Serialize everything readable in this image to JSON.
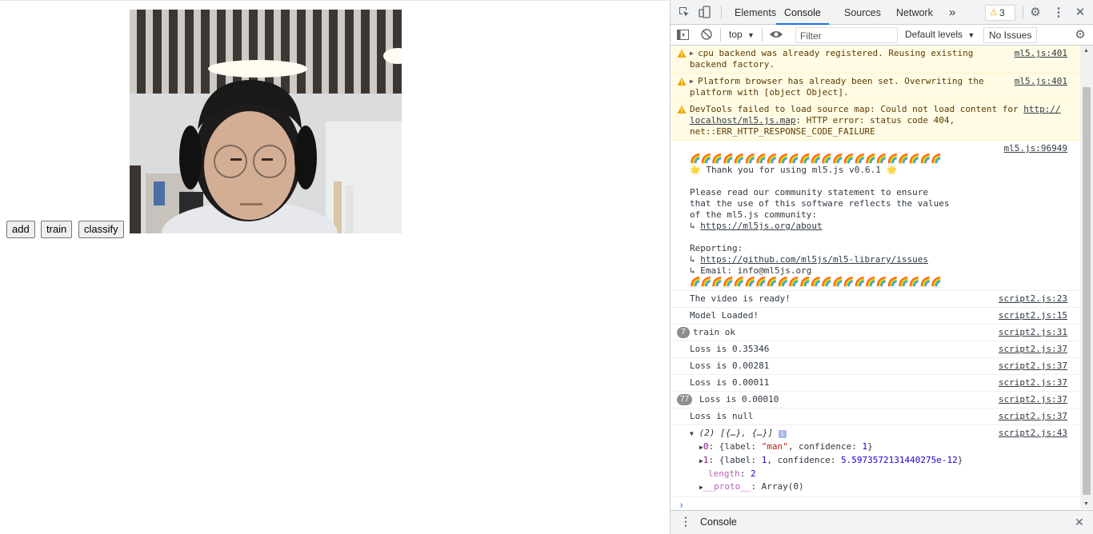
{
  "page": {
    "buttons": {
      "add": "add",
      "train": "train",
      "classify": "classify"
    }
  },
  "devtools": {
    "tabs": [
      "Elements",
      "Console",
      "Sources",
      "Network"
    ],
    "more_tabs": "»",
    "warnings_badge": "3",
    "context": "top",
    "filter_placeholder": "Filter",
    "levels": "Default levels",
    "issues": "No Issues",
    "drawer_tab": "Console",
    "messages": {
      "w1": {
        "text": "cpu backend was already registered. Reusing existing\nbackend factory.",
        "src": "ml5.js:401"
      },
      "w2": {
        "text": "Platform browser has already been set. Overwriting the\nplatform with [object Object].",
        "src": "ml5.js:401"
      },
      "w3": {
        "text_a": "DevTools failed to load source map: Could not load content for ",
        "link": "http://\nlocalhost/ml5.js.map",
        "text_b": ": HTTP error: status code 404,\nnet::ERR_HTTP_RESPONSE_CODE_FAILURE"
      },
      "banner": {
        "src": "ml5.js:96949",
        "rainbow": "🌈🌈🌈🌈🌈🌈🌈🌈🌈🌈🌈🌈🌈🌈🌈🌈🌈🌈🌈🌈🌈🌈🌈",
        "thanks": "🌟 Thank you for using ml5.js v0.6.1 🌟",
        "p1": "Please read our community statement to ensure\nthat the use of this software reflects the values\nof the ml5.js community:",
        "arrow1": "↳ ",
        "about": "https://ml5js.org/about",
        "reporting": "Reporting:",
        "arrow2": "↳ ",
        "issues_url": "https://github.com/ml5js/ml5-library/issues",
        "email": "↳ Email: info@ml5js.org"
      },
      "logs": [
        {
          "count": "",
          "text": "The video is ready!",
          "src": "script2.js:23"
        },
        {
          "count": "",
          "text": "Model Loaded!",
          "src": "script2.js:15"
        },
        {
          "count": "7",
          "text": "train ok",
          "src": "script2.js:31"
        },
        {
          "count": "",
          "text": "Loss is 0.35346",
          "src": "script2.js:37"
        },
        {
          "count": "",
          "text": "Loss is 0.00281",
          "src": "script2.js:37"
        },
        {
          "count": "",
          "text": "Loss is 0.00011",
          "src": "script2.js:37"
        },
        {
          "count": "77",
          "text": "Loss is 0.00010",
          "src": "script2.js:37"
        },
        {
          "count": "",
          "text": "Loss is null",
          "src": "script2.js:37"
        }
      ],
      "array": {
        "summary": "(2) [{…}, {…}]",
        "src": "script2.js:43",
        "i0_key": "0",
        "i0_a": ": {label: ",
        "i0_label": "\"man\"",
        "i0_b": ", confidence: ",
        "i0_conf": "1",
        "i0_c": "}",
        "i1_key": "1",
        "i1_a": ": {label: ",
        "i1_label": "1",
        "i1_b": ", confidence: ",
        "i1_conf": "5.5973572131440275e-12",
        "i1_c": "}",
        "length_key": "length",
        "length_val": "2",
        "proto_key": "__proto__",
        "proto_val": ": Array(0)"
      }
    }
  }
}
